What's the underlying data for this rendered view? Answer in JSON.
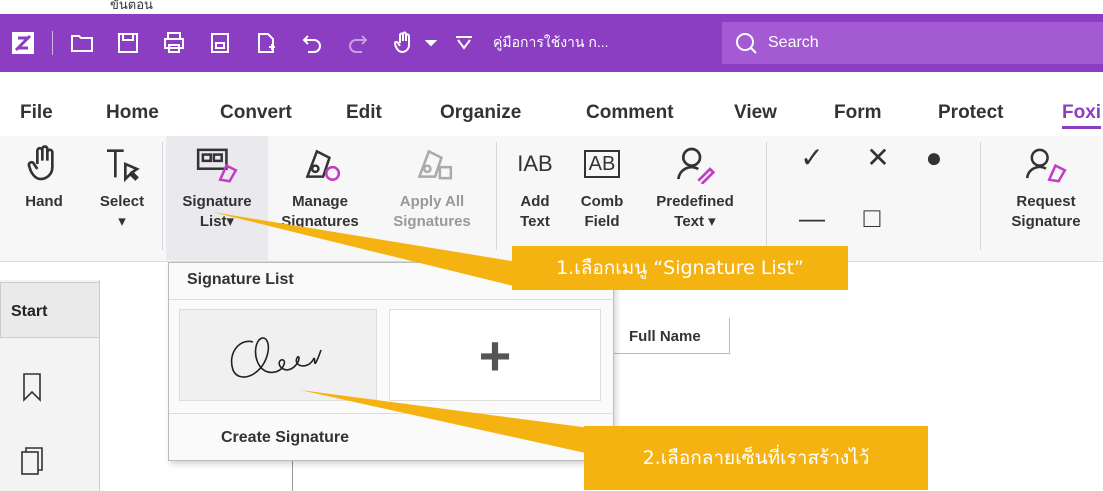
{
  "top_label": "ขั้นตอน",
  "titlebar": {
    "doc_name": "คู่มือการใช้งาน ก...",
    "search_placeholder": "Search",
    "icons": [
      "app-logo-icon",
      "open-folder-icon",
      "save-icon",
      "print-icon",
      "scan-icon",
      "new-doc-icon",
      "undo-icon",
      "redo-icon",
      "hand-tool-icon",
      "dropdown-icon",
      "customize-icon"
    ]
  },
  "menu": {
    "tabs": [
      "File",
      "Home",
      "Convert",
      "Edit",
      "Organize",
      "Comment",
      "View",
      "Form",
      "Protect",
      "Foxi"
    ],
    "active": "Foxi"
  },
  "ribbon": {
    "hand": "Hand",
    "select": "Select",
    "signature_list_1": "Signature",
    "signature_list_2": "List▾",
    "manage_1": "Manage",
    "manage_2": "Signatures",
    "apply_1": "Apply All",
    "apply_2": "Signatures",
    "add_text_1": "Add",
    "add_text_2": "Text",
    "comb_1": "Comb",
    "comb_2": "Field",
    "predef_1": "Predefined",
    "predef_2": "Text ▾",
    "request_1": "Request",
    "request_2": "Signature",
    "ab_label": "AB"
  },
  "left_panel": {
    "start": "Start"
  },
  "dropdown": {
    "title": "Signature List",
    "add_symbol": "+",
    "create": "Create Signature"
  },
  "full_name": "Full Name",
  "callouts": {
    "step1": "1.เลือกเมนู “Signature List”",
    "step2": "2.เลือกลายเซ็นที่เราสร้างไว้"
  },
  "colors": {
    "titlebar": "#8b3ec1",
    "search": "#a45ad3",
    "callout": "#f5b312"
  }
}
